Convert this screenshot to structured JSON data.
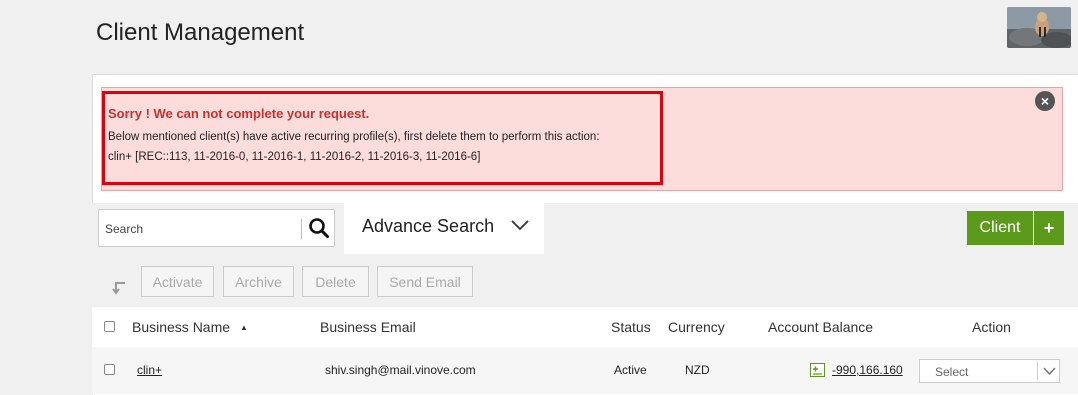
{
  "page": {
    "title": "Client Management"
  },
  "alert": {
    "title": "Sorry ! We can not complete your request.",
    "line1": "Below mentioned client(s) have active recurring profile(s), first delete them to perform this action:",
    "line2": "clin+ [REC::113, 11-2016-0, 11-2016-1, 11-2016-2, 11-2016-3, 11-2016-6]",
    "close_icon": "close-circle-icon"
  },
  "search": {
    "placeholder": "Search",
    "value": ""
  },
  "advanced_search": {
    "label": "Advance Search"
  },
  "client_button": {
    "label": "Client",
    "plus": "+"
  },
  "bulk_actions": {
    "activate": "Activate",
    "archive": "Archive",
    "delete": "Delete",
    "send_email": "Send Email"
  },
  "table": {
    "headers": {
      "business_name": "Business Name",
      "business_email": "Business Email",
      "status": "Status",
      "currency": "Currency",
      "account_balance": "Account Balance",
      "action": "Action"
    },
    "sort_indicator": "▲",
    "rows": [
      {
        "business_name": "clin+",
        "business_email": "shiv.singh@mail.vinove.com",
        "status": "Active",
        "currency": "NZD",
        "account_balance": "-990,166.160",
        "action": "Select"
      }
    ]
  },
  "colors": {
    "accent_green": "#5b9a1a",
    "alert_bg": "#fddcdc",
    "alert_highlight": "#e0000b",
    "alert_title": "#c9302c"
  }
}
